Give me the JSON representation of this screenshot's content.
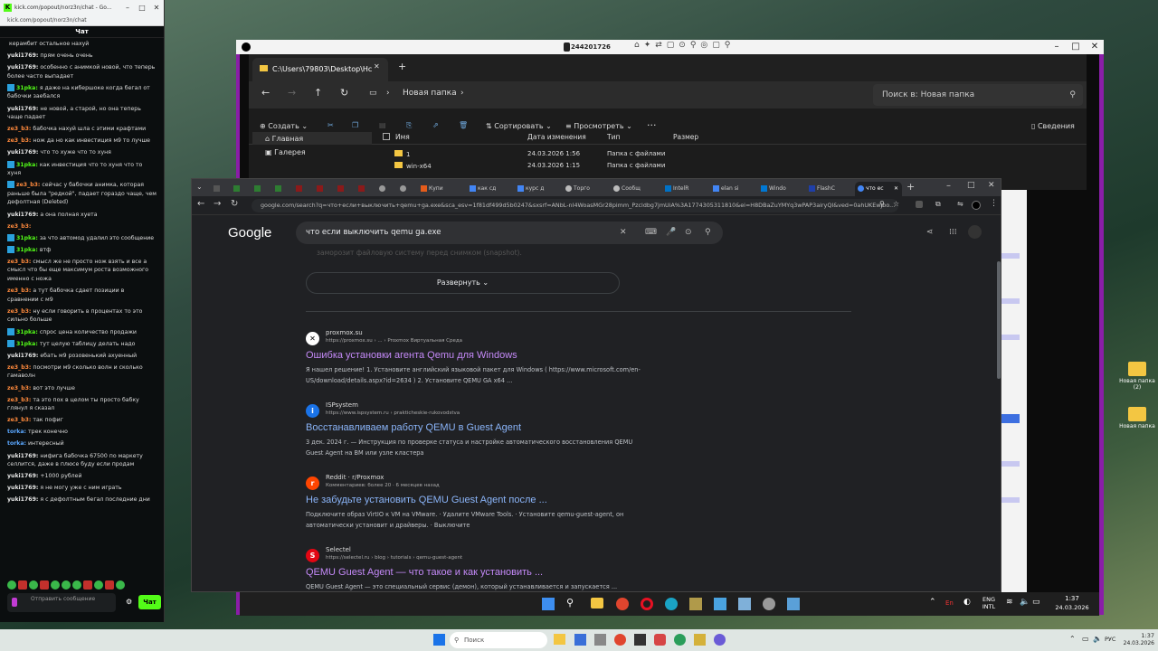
{
  "kick": {
    "title": "kick.com/popout/norz3n/chat - Go...",
    "url": "kick.com/popout/norz3n/chat",
    "header": "Чат",
    "messages": [
      {
        "user": "",
        "text": "керамбит остальное нахуй",
        "color": "#ddd"
      },
      {
        "user": "yuki1769:",
        "text": "прям очень очень",
        "color": "#e8e8e8"
      },
      {
        "user": "yuki1769:",
        "text": "особенно с анимкой новой, что теперь более часто выпадает",
        "color": "#e8e8e8"
      },
      {
        "user": "31pka:",
        "text": "я даже на кибершоке когда бегал от бабочки заебался",
        "color": "#53fc18",
        "badge": true
      },
      {
        "user": "yuki1769:",
        "text": "не новой, а старой, но она теперь чаще падает",
        "color": "#e8e8e8"
      },
      {
        "user": "ze3_b3:",
        "text": "бабочка нахуй шла с этими крафтами",
        "color": "#ff8a3d"
      },
      {
        "user": "ze3_b3:",
        "text": "нож да но как инвестиция м9 то лучше",
        "color": "#ff8a3d"
      },
      {
        "user": "yuki1769:",
        "text": "что то хуже что то хуня",
        "color": "#e8e8e8"
      },
      {
        "user": "31pka:",
        "text": "как инвестиция что то хуня что то хуня",
        "color": "#53fc18",
        "badge": true
      },
      {
        "user": "ze3_b3:",
        "text": "сейчас у бабочки анимка, которая раньше была \"редкой\", падает гораздо чаще, чем дефолтная (Deleted)",
        "color": "#ff8a3d",
        "badge": true
      },
      {
        "user": "yuki1769:",
        "text": "а она полная хуета",
        "color": "#e8e8e8"
      },
      {
        "user": "ze3_b3:",
        "text": "",
        "color": "#ff8a3d"
      },
      {
        "user": "31pka:",
        "text": "за что автомод удалил это сообщение",
        "color": "#53fc18",
        "badge": true
      },
      {
        "user": "31pka:",
        "text": "втф",
        "color": "#53fc18",
        "badge": true
      },
      {
        "user": "ze3_b3:",
        "text": "смысл же не просто нож взять и все а смысл что бы еще максимум роста возможного именно с ножа",
        "color": "#ff8a3d"
      },
      {
        "user": "ze3_b3:",
        "text": "а тут бабочка сдает позиции в сравнении с м9",
        "color": "#ff8a3d"
      },
      {
        "user": "ze3_b3:",
        "text": "ну если говорить в процентах то это сильно больше",
        "color": "#ff8a3d"
      },
      {
        "user": "31pka:",
        "text": "спрос цена количество продажи",
        "color": "#53fc18",
        "badge": true
      },
      {
        "user": "31pka:",
        "text": "тут целую таблицу делать надо",
        "color": "#53fc18",
        "badge": true
      },
      {
        "user": "yuki1769:",
        "text": "ебать м9 розовенький ахуенный",
        "color": "#e8e8e8"
      },
      {
        "user": "ze3_b3:",
        "text": "посмотри м9 сколько волн и сколько гамаволн",
        "color": "#ff8a3d"
      },
      {
        "user": "ze3_b3:",
        "text": "вот это лучше",
        "color": "#ff8a3d"
      },
      {
        "user": "ze3_b3:",
        "text": "та это пох в целом ты просто бабку глянул я сказал",
        "color": "#ff8a3d"
      },
      {
        "user": "ze3_b3:",
        "text": "так пофиг",
        "color": "#ff8a3d"
      },
      {
        "user": "torka:",
        "text": "трек конечно",
        "color": "#5aa7ff"
      },
      {
        "user": "torka:",
        "text": "интересный",
        "color": "#5aa7ff"
      },
      {
        "user": "yuki1769:",
        "text": "нифига бабочка 67500 по маркету селлится, даже в плюсе буду если продам",
        "color": "#e8e8e8"
      },
      {
        "user": "yuki1769:",
        "text": "+1000 рублей",
        "color": "#e8e8e8"
      },
      {
        "user": "yuki1769:",
        "text": "я не могу уже с ним играть",
        "color": "#e8e8e8"
      },
      {
        "user": "yuki1769:",
        "text": "я с дефолтным бегал последние дни",
        "color": "#e8e8e8"
      }
    ],
    "input_placeholder": "Отправить сообщение",
    "send": "Чат"
  },
  "remote": {
    "id": "244201726"
  },
  "explorer": {
    "tab": "C:\\Users\\79803\\Desktop\\Нс",
    "path": "Новая папка",
    "search_ph": "Поиск в: Новая папка",
    "create": "Создать",
    "sort": "Сортировать",
    "view": "Просмотреть",
    "details": "Сведения",
    "side": [
      "Главная",
      "Галерея"
    ],
    "cols": [
      "Имя",
      "Дата изменения",
      "Тип",
      "Размер"
    ],
    "rows": [
      {
        "n": "1",
        "d": "24.03.2026 1:56",
        "t": "Папка с файлами"
      },
      {
        "n": "win-x64",
        "d": "24.03.2026 1:15",
        "t": "Папка с файлами"
      }
    ]
  },
  "chrome": {
    "url": "google.com/search?q=что+если+выключить+qemu+ga.exe&sca_esv=1f81df499d5b0247&sxsrf=ANbL-nI4WoasMGr28pimm_Pzcldbg7jmUiA%3A1774305311810&ei=H8DBaZuYMYq3wPAP3airyQI&ved=0ahUKEwjbo...",
    "tabs": [
      "Купи",
      "как сд",
      "курс д",
      "Торго",
      "Сообщ",
      "IntelR",
      "elan si",
      "Windo",
      "FlashC",
      "что ес"
    ]
  },
  "google": {
    "logo": "Google",
    "query": "что если выключить qemu ga.exe",
    "faded": "заморозит файловую систему перед снимком (snapshot).",
    "expand": "Развернуть",
    "results": [
      {
        "site": "proxmox.su",
        "crumb": "https://proxmox.su › ... › Proxmox Виртуальная Среда",
        "title": "Ошибка установки агента Qemu для Windows",
        "snip": "Я нашел решение! 1. Установите английский языковой пакет для Windows ( https://www.microsoft.com/en-US/download/details.aspx?id=2634 ) 2. Установите QEMU GA x64 ...",
        "icon": "✕"
      },
      {
        "site": "ISPsystem",
        "crumb": "https://www.ispsystem.ru › prakticheskie-rukovodstva",
        "title": "Восстанавливаем работу QEMU в Guest Agent",
        "snip": "3 дек. 2024 г. — Инструкция по проверке статуса и настройке автоматического восстановления QEMU Guest Agent на ВМ или узле кластера",
        "icon": "i"
      },
      {
        "site": "Reddit · r/Proxmox",
        "crumb": "Комментариев: более 20 · 6 месяцев назад",
        "title": "Не забудьте установить QEMU Guest Agent после ...",
        "snip": "Подключите образ VirtIO к VM на VMware. · Удалите VMware Tools. · Установите qemu-guest-agent, он автоматически установит и драйверы. · Выключите",
        "icon": "r"
      },
      {
        "site": "Selectel",
        "crumb": "https://selectel.ru › blog › tutorials › qemu-guest-agent",
        "title": "QEMU Guest Agent — что такое и как установить ...",
        "snip": "QEMU Guest Agent — это специальный сервис (демон), который устанавливается и запускается ...",
        "icon": "S"
      }
    ]
  },
  "desk": {
    "icons": [
      "Новая папка (2)",
      "Новая папка"
    ]
  },
  "rtask": {
    "lang": "ENG INTL",
    "time": "1:37",
    "date": "24.03.2026"
  },
  "htask": {
    "search": "Поиск",
    "lang": "РУС",
    "time": "1:37",
    "date": "24.03.2026"
  }
}
